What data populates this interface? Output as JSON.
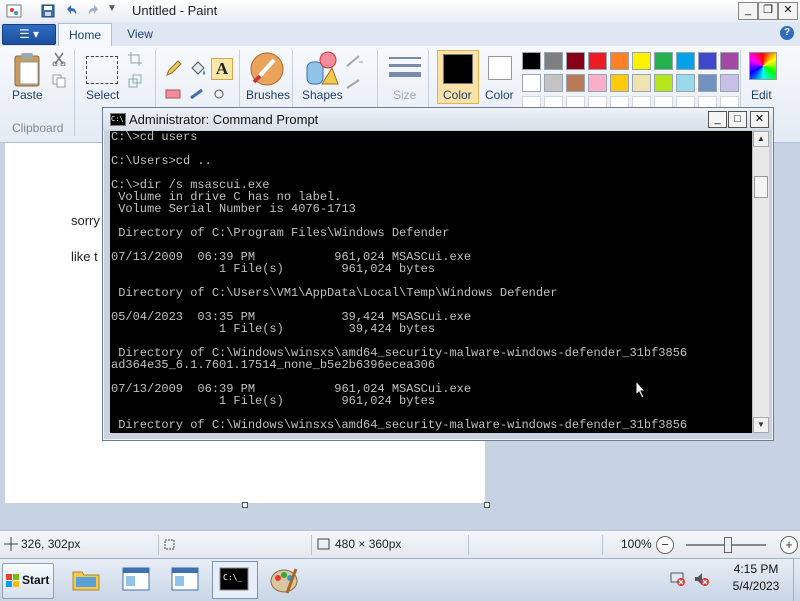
{
  "paint": {
    "title": "Untitled - Paint",
    "tabs": {
      "file": "☰ ▾",
      "home": "Home",
      "view": "View"
    },
    "help": "?",
    "ribbon": {
      "paste": "Paste",
      "select": "Select",
      "clipboard_group": "Clipboard",
      "brushes": "Brushes",
      "shapes": "Shapes",
      "size": "Size",
      "color1": "Color\n1",
      "color1_label": "Color",
      "color2_label": "Color",
      "edit_colors": "Edit"
    },
    "palette_row1": [
      "#000000",
      "#7f7f7f",
      "#880015",
      "#ed1c24",
      "#ff7f27",
      "#fff200",
      "#22b14c",
      "#00a2e8",
      "#3f48cc",
      "#a349a4"
    ],
    "palette_row2": [
      "#ffffff",
      "#c3c3c3",
      "#b97a57",
      "#ffaec9",
      "#ffc90e",
      "#efe4b0",
      "#b5e61d",
      "#99d9ea",
      "#7092be",
      "#c8bfe7"
    ],
    "canvas_text": {
      "line1": "sorry",
      "line2": "like t"
    },
    "status": {
      "cursor_pos": "326, 302px",
      "canvas_size": "480 × 360px",
      "zoom": "100%"
    }
  },
  "cmd": {
    "title": "Administrator: Command Prompt",
    "lines": [
      "C:\\>cd users",
      "",
      "C:\\Users>cd ..",
      "",
      "C:\\>dir /s msascui.exe",
      " Volume in drive C has no label.",
      " Volume Serial Number is 4076-1713",
      "",
      " Directory of C:\\Program Files\\Windows Defender",
      "",
      "07/13/2009  06:39 PM           961,024 MSASCui.exe",
      "               1 File(s)        961,024 bytes",
      "",
      " Directory of C:\\Users\\VM1\\AppData\\Local\\Temp\\Windows Defender",
      "",
      "05/04/2023  03:35 PM            39,424 MSASCui.exe",
      "               1 File(s)         39,424 bytes",
      "",
      " Directory of C:\\Windows\\winsxs\\amd64_security-malware-windows-defender_31bf3856",
      "ad364e35_6.1.7601.17514_none_b5e2b6396ecea306",
      "",
      "07/13/2009  06:39 PM           961,024 MSASCui.exe",
      "               1 File(s)        961,024 bytes",
      "",
      " Directory of C:\\Windows\\winsxs\\amd64_security-malware-windows-defender_31bf3856"
    ]
  },
  "taskbar": {
    "start_label": "Start",
    "time": "4:15 PM",
    "date": "5/4/2023"
  }
}
